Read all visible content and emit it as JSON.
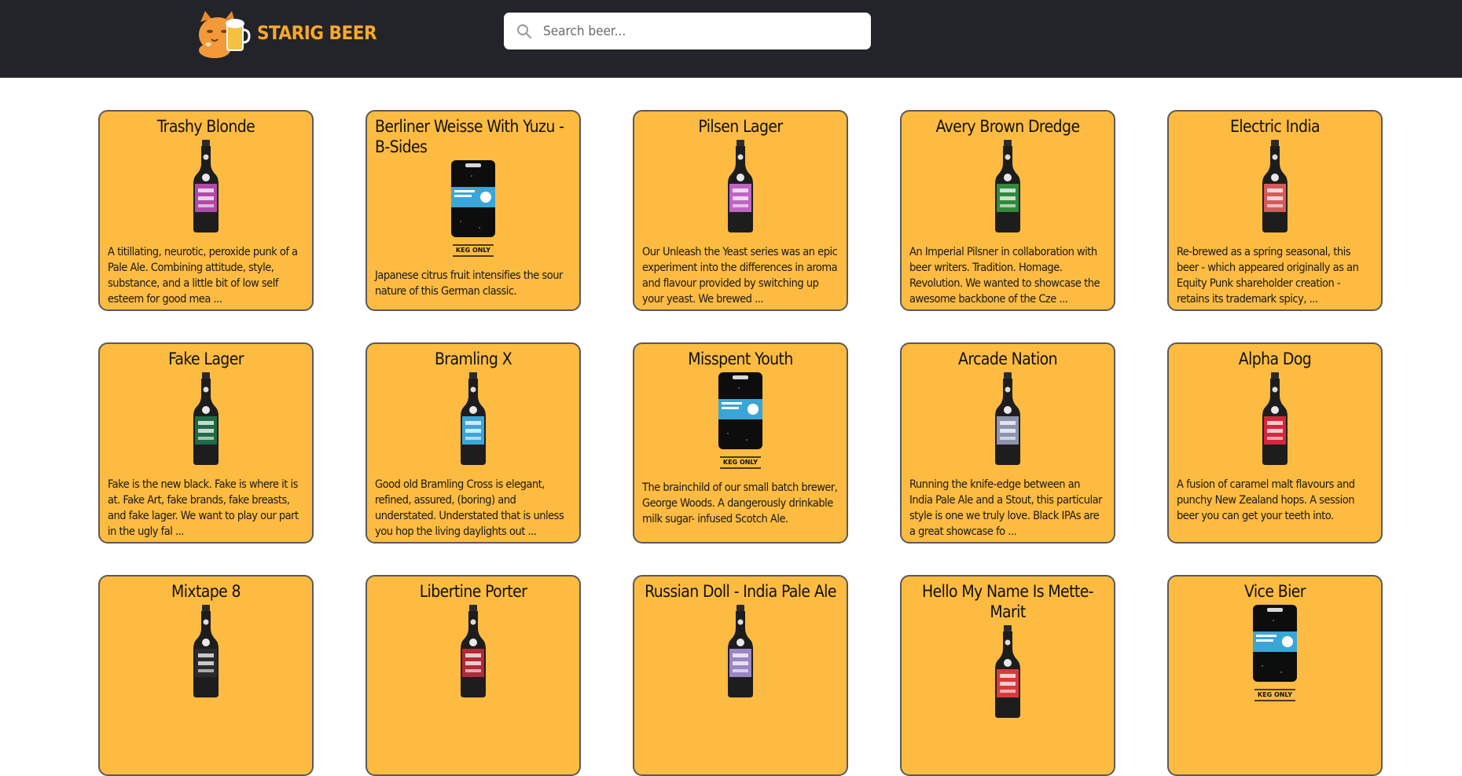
{
  "header": {
    "brand": "STARIG BEER",
    "search_placeholder": "Search beer..."
  },
  "colors": {
    "header_bg": "#23232a",
    "brand": "#f7a929",
    "card_bg": "#fdbb41",
    "card_border": "#5a5a5a"
  },
  "beers": [
    {
      "name": "Trashy Blonde",
      "description": "A titillating, neurotic, peroxide punk of a Pale Ale. Combining attitude, style, substance, and a little bit of low self esteem for good mea ...",
      "image": "bottle",
      "label_color": "#b04aa8"
    },
    {
      "name": "Berliner Weisse With Yuzu - B-Sides",
      "description": "Japanese citrus fruit intensifies the sour nature of this German classic.",
      "image": "keg",
      "keg_label": "KEG ONLY"
    },
    {
      "name": "Pilsen Lager",
      "description": "Our Unleash the Yeast series was an epic experiment into the differences in aroma and flavour provided by switching up your yeast. We brewed ...",
      "image": "bottle",
      "label_color": "#c064c4"
    },
    {
      "name": "Avery Brown Dredge",
      "description": "An Imperial Pilsner in collaboration with beer writers. Tradition. Homage. Revolution. We wanted to showcase the awesome backbone of the Cze ...",
      "image": "bottle",
      "label_color": "#2f8a3a"
    },
    {
      "name": "Electric India",
      "description": "Re-brewed as a spring seasonal, this beer - which appeared originally as an Equity Punk shareholder creation - retains its trademark spicy, ...",
      "image": "bottle",
      "label_color": "#d45a5a"
    },
    {
      "name": "Fake Lager",
      "description": "Fake is the new black. Fake is where it is at. Fake Art, fake brands, fake breasts, and fake lager. We want to play our part in the ugly fal ...",
      "image": "bottle",
      "label_color": "#1f6b47"
    },
    {
      "name": "Bramling X",
      "description": "Good old Bramling Cross is elegant, refined, assured, (boring) and understated. Understated that is unless you hop the living daylights out ...",
      "image": "bottle",
      "label_color": "#3aa6d8"
    },
    {
      "name": "Misspent Youth",
      "description": "The brainchild of our small batch brewer, George Woods. A dangerously drinkable milk sugar- infused Scotch Ale.",
      "image": "keg",
      "keg_label": "KEG ONLY"
    },
    {
      "name": "Arcade Nation",
      "description": "Running the knife-edge between an India Pale Ale and a Stout, this particular style is one we truly love. Black IPAs are a great showcase fo ...",
      "image": "bottle",
      "label_color": "#8b93ad"
    },
    {
      "name": "Alpha Dog",
      "description": "A fusion of caramel malt flavours and punchy New Zealand hops. A session beer you can get your teeth into.",
      "image": "bottle",
      "label_color": "#d8253c"
    },
    {
      "name": "Mixtape 8",
      "description": "",
      "image": "bottle",
      "label_color": "#2b2b2b"
    },
    {
      "name": "Libertine Porter",
      "description": "",
      "image": "bottle",
      "label_color": "#b02a3a"
    },
    {
      "name": "Russian Doll - India Pale Ale",
      "description": "",
      "image": "bottle",
      "label_color": "#9b86c4"
    },
    {
      "name": "Hello My Name Is Mette-Marit",
      "description": "",
      "image": "bottle",
      "label_color": "#d83a3a"
    },
    {
      "name": "Vice Bier",
      "description": "",
      "image": "keg",
      "keg_label": "KEG ONLY"
    }
  ]
}
